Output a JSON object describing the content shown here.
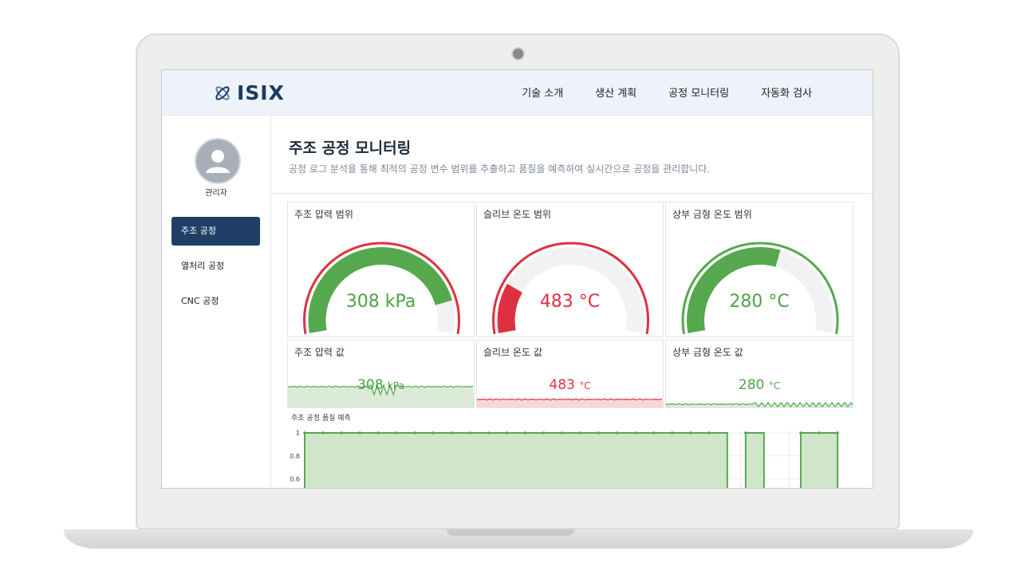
{
  "header": {
    "logo_text": "ISIX",
    "nav": [
      "기술 소개",
      "생산 계획",
      "공정 모니터링",
      "자동화 검사"
    ]
  },
  "sidebar": {
    "user_label": "관리자",
    "items": [
      {
        "label": "주조 공정",
        "active": true
      },
      {
        "label": "열처리 공정",
        "active": false
      },
      {
        "label": "CNC 공정",
        "active": false
      }
    ]
  },
  "main": {
    "title": "주조 공정 모니터링",
    "description": "공정 로그 분석을 통해 최적의 공정 변수 범위를 추출하고 품질을 예측하여 실시간으로 공정을 관리합니다."
  },
  "gauges": [
    {
      "title": "주조 압력 범위",
      "value_text": "308 kPa",
      "fill_fraction": 0.87,
      "fill_color": "#55a84d",
      "ring_color": "#e0303f",
      "text_color": "#4ea346"
    },
    {
      "title": "슬리브 온도 범위",
      "value_text": "483 °C",
      "fill_fraction": 0.2,
      "fill_color": "#e0303f",
      "ring_color": "#e0303f",
      "text_color": "#e0303f"
    },
    {
      "title": "상부 금형 온도 범위",
      "value_text": "280 °C",
      "fill_fraction": 0.58,
      "fill_color": "#55a84d",
      "ring_color": "#55a84d",
      "text_color": "#4ea346"
    }
  ],
  "sparks": [
    {
      "title": "주조 압력 값",
      "value": "308",
      "unit": "kPa",
      "line_color": "#55a84d",
      "area_color": "#dcebd8",
      "text_color": "#4ea346"
    },
    {
      "title": "슬리브 온도 값",
      "value": "483",
      "unit": "°C",
      "line_color": "#e0303f",
      "area_color": "#f8d6da",
      "text_color": "#e0303f"
    },
    {
      "title": "상부 금형 온도 값",
      "value": "280",
      "unit": "°C",
      "line_color": "#55a84d",
      "area_color": "#dcebd8",
      "text_color": "#4ea346"
    }
  ],
  "quality": {
    "title": "주조 공정 품질 예측",
    "chart_data": {
      "type": "area",
      "title": "주조 공정 품질 예측",
      "y_ticks": [
        "1",
        "0.8",
        "0.6"
      ],
      "ylim": [
        0.5,
        1
      ],
      "x_count": 30,
      "values": [
        1,
        1,
        1,
        1,
        1,
        1,
        1,
        1,
        1,
        1,
        1,
        1,
        1,
        1,
        1,
        1,
        1,
        1,
        1,
        1,
        1,
        1,
        1,
        0,
        1,
        0,
        0,
        1,
        1,
        1
      ],
      "color": "#55a84d"
    }
  }
}
